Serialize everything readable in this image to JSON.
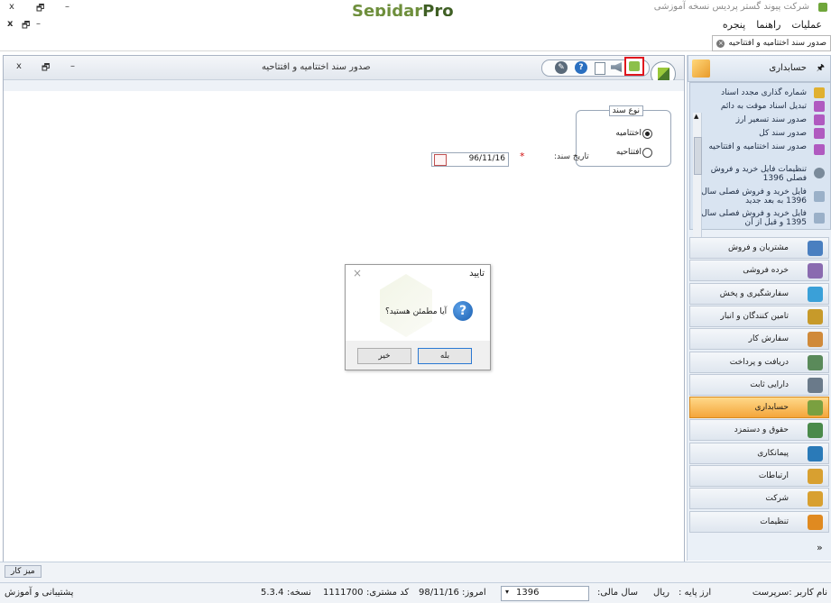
{
  "app": {
    "title": "شرکت پیوند گستر پردیس نسخه آموزشی",
    "brand_a": "Sepidar",
    "brand_b": "Pro"
  },
  "window_controls": {
    "close": "x",
    "restore": "🗗",
    "minimize": "–"
  },
  "menu": [
    "عملیات",
    "راهنما",
    "پنجره"
  ],
  "doc_tab": {
    "label": "صدور سند اختتامیه و افتتاحیه"
  },
  "form": {
    "title": "صدور سند اختتامیه و افتتاحیه",
    "group_label": "نوع سند",
    "options": [
      {
        "label": "اختتامیه",
        "selected": true
      },
      {
        "label": "افتتاحیه",
        "selected": false
      }
    ],
    "date_label": "تاریخ سند:",
    "required_mark": "*",
    "date_value": "96/11/16"
  },
  "dialog": {
    "title": "تایید",
    "message": "آیا مطمئن هستید؟",
    "yes": "بله",
    "no": "خیر",
    "close": "×",
    "question_glyph": "?"
  },
  "sidebar": {
    "title": "حسابداری",
    "pin": "🖈",
    "list_items": [
      "شماره گذاری مجدد اسناد",
      "تبدیل اسناد موقت به دائم",
      "صدور سند تسعیر ارز",
      "صدور سند کل",
      "صدور سند اختتامیه و افتتاحیه",
      "تنظیمات فایل خرید و فروش فصلی 1396",
      "فایل خرید و فروش فصلی سال 1396 به بعد جدید",
      "فایل خرید و فروش فصلی سال 1395 و قبل از آن"
    ],
    "nav": [
      {
        "label": "مشتریان و فروش",
        "color": "#4a7fc0"
      },
      {
        "label": "خرده فروشی",
        "color": "#8a6bb0"
      },
      {
        "label": "سفارشگیری و پخش",
        "color": "#3aa0d8"
      },
      {
        "label": "تامین کنندگان و انبار",
        "color": "#c79a2a"
      },
      {
        "label": "سفارش کار",
        "color": "#d08a3a"
      },
      {
        "label": "دریافت و پرداخت",
        "color": "#5a8a5a"
      },
      {
        "label": "دارایی ثابت",
        "color": "#6a7a8a"
      },
      {
        "label": "حسابداری",
        "color": "#7aa040",
        "active": true
      },
      {
        "label": "حقوق و دستمزد",
        "color": "#4a8a4a"
      },
      {
        "label": "پیمانکاری",
        "color": "#2a7ab8"
      },
      {
        "label": "ارتباطات",
        "color": "#d8a030"
      },
      {
        "label": "شرکت",
        "color": "#d8a030"
      },
      {
        "label": "تنظیمات",
        "color": "#e08a20"
      }
    ],
    "more": "»"
  },
  "taskbar": {
    "desktop": "میز کار"
  },
  "status": {
    "support": "پشتیبانی و آموزش",
    "version_label": "نسخه:",
    "version": "5.3.4",
    "customer_label": "کد مشتری:",
    "customer_code": "1111700",
    "today_label": "امروز:",
    "today": "98/11/16",
    "year": "1396",
    "fiscal_label": "سال مالی:",
    "currency": "ریال",
    "base_currency_label": "ارز پایه :",
    "user": "نام کاربر :سرپرست"
  }
}
